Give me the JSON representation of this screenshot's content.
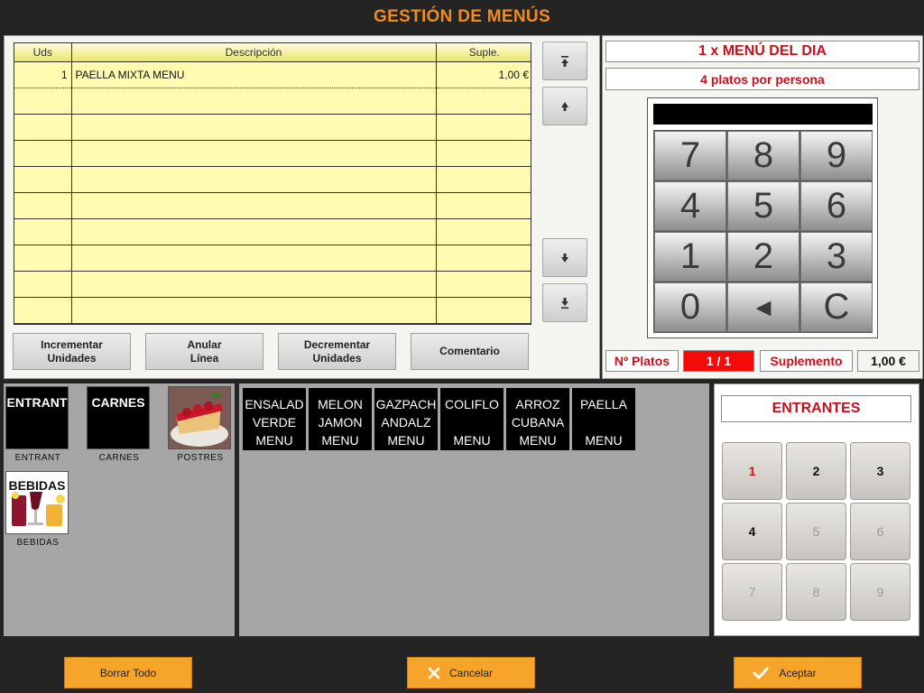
{
  "title": "GESTIÓN DE MENÚS",
  "order": {
    "columns": [
      "Uds",
      "Descripción",
      "Suple."
    ],
    "rows": [
      {
        "uds": "1",
        "desc": "PAELLA MIXTA MENU",
        "sup": "1,00 €"
      },
      {
        "uds": "",
        "desc": "",
        "sup": ""
      },
      {
        "uds": "",
        "desc": "",
        "sup": ""
      },
      {
        "uds": "",
        "desc": "",
        "sup": ""
      },
      {
        "uds": "",
        "desc": "",
        "sup": ""
      },
      {
        "uds": "",
        "desc": "",
        "sup": ""
      },
      {
        "uds": "",
        "desc": "",
        "sup": ""
      },
      {
        "uds": "",
        "desc": "",
        "sup": ""
      },
      {
        "uds": "",
        "desc": "",
        "sup": ""
      },
      {
        "uds": "",
        "desc": "",
        "sup": ""
      }
    ],
    "actions": {
      "increment": "Incrementar\nUnidades",
      "cancel_line": "Anular\nLínea",
      "decrement": "Decrementar\nUnidades",
      "comment": "Comentario"
    }
  },
  "menu": {
    "title": "1 x MENÚ DEL DIA",
    "subtitle": "4 platos por persona",
    "keypad": [
      "7",
      "8",
      "9",
      "4",
      "5",
      "6",
      "1",
      "2",
      "3",
      "0",
      "◄",
      "C"
    ],
    "platos_label": "Nº Platos",
    "platos_value": "1 / 1",
    "suplemento_label": "Suplemento",
    "suplemento_value": "1,00 €",
    "platos_bg": "#f50a0a"
  },
  "categories": [
    {
      "tile": "ENTRANT",
      "name": "ENTRANT",
      "image": false
    },
    {
      "tile": "CARNES",
      "name": "CARNES",
      "image": false
    },
    {
      "tile": "",
      "name": "POSTRES",
      "image": true
    },
    {
      "tile": "BEBIDAS",
      "name": "BEBIDAS",
      "image": true
    }
  ],
  "dishes": [
    "ENSALAD\nVERDE\nMENU",
    "MELON\nJAMON\nMENU",
    "GAZPACH\nANDALZ\nMENU",
    "COLIFLO\n\nMENU",
    "ARROZ\nCUBANA\nMENU",
    "PAELLA\n\nMENU"
  ],
  "course": {
    "title": "ENTRANTES",
    "numbers": [
      "1",
      "2",
      "3",
      "4",
      "5",
      "6",
      "7",
      "8",
      "9"
    ]
  },
  "footer": {
    "clear_all": "Borrar Todo",
    "cancel": "Cancelar",
    "accept": "Aceptar"
  },
  "colors": {
    "accent": "#f28a1e",
    "button_orange": "#f6a52a",
    "table_bg": "#fffbb0",
    "red_text": "#c8101c"
  }
}
